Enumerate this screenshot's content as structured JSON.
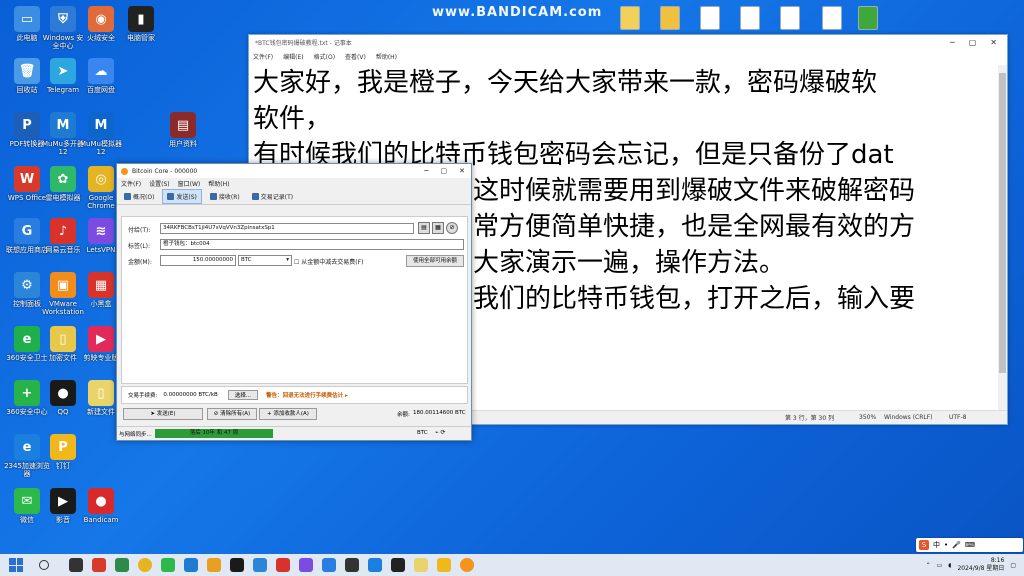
{
  "watermark": "www.BANDICAM.com",
  "desktop_icons": [
    {
      "label": "此电脑",
      "color": "#3a8de0",
      "glyph": "▭"
    },
    {
      "label": "Windows 安全中心",
      "color": "#2d7bd6",
      "glyph": "⛨"
    },
    {
      "label": "火绒安全",
      "color": "#e06a3a",
      "glyph": "◉"
    },
    {
      "label": "电脑管家",
      "color": "#222222",
      "glyph": "▮"
    },
    {
      "label": "回收站",
      "color": "#4a9ae8",
      "glyph": "🗑"
    },
    {
      "label": "Telegram",
      "color": "#2ea6e0",
      "glyph": "➤"
    },
    {
      "label": "百度网盘",
      "color": "#3a86f0",
      "glyph": "☁"
    },
    {
      "label": "PDF转换器",
      "color": "#1d5fb8",
      "glyph": "P"
    },
    {
      "label": "MuMu多开器12",
      "color": "#1f7ad1",
      "glyph": "M"
    },
    {
      "label": "MuMu模拟器12",
      "color": "#0c66cc",
      "glyph": "M"
    },
    {
      "label": "用户资料",
      "color": "#8b2a2a",
      "glyph": "▤"
    },
    {
      "label": "WPS Office",
      "color": "#d83a2a",
      "glyph": "W"
    },
    {
      "label": "雷电模拟器",
      "color": "#2fb86a",
      "glyph": "✿"
    },
    {
      "label": "Google Chrome",
      "color": "#e6b323",
      "glyph": "◎"
    },
    {
      "label": "联想应用商店",
      "color": "#2a7de0",
      "glyph": "G"
    },
    {
      "label": "网易云音乐",
      "color": "#d8322a",
      "glyph": "♪"
    },
    {
      "label": "LetsVPN",
      "color": "#7c4ce0",
      "glyph": "≋"
    },
    {
      "label": "控制面板",
      "color": "#2c86d8",
      "glyph": "⚙"
    },
    {
      "label": "VMware Workstation",
      "color": "#f28c1a",
      "glyph": "▣"
    },
    {
      "label": "小黑盒",
      "color": "#d8332a",
      "glyph": "▦"
    },
    {
      "label": "360安全卫士",
      "color": "#1fb04c",
      "glyph": "e"
    },
    {
      "label": "加密文件",
      "color": "#e8c84a",
      "glyph": "▯"
    },
    {
      "label": "剪映专业版",
      "color": "#e22a5a",
      "glyph": "▶"
    },
    {
      "label": "360安全中心",
      "color": "#27b24a",
      "glyph": "+"
    },
    {
      "label": "QQ",
      "color": "#1a1a1a",
      "glyph": "●"
    },
    {
      "label": "新建文件",
      "color": "#e8d46a",
      "glyph": "▯"
    },
    {
      "label": "2345加速浏览器",
      "color": "#1b7fe0",
      "glyph": "e"
    },
    {
      "label": "钉钉",
      "color": "#f0b81a",
      "glyph": "P"
    },
    {
      "label": "微信",
      "color": "#2db84a",
      "glyph": "✉"
    },
    {
      "label": "影音",
      "color": "#1a1a1a",
      "glyph": "▶"
    },
    {
      "label": "Bandicam",
      "color": "#d82a2a",
      "glyph": "●"
    }
  ],
  "top_icons": [
    {
      "color": "#f2d15a"
    },
    {
      "color": "#f0c040"
    },
    {
      "color": "#ffffff"
    },
    {
      "color": "#ffffff"
    },
    {
      "color": "#ffffff"
    },
    {
      "color": "#ffffff"
    },
    {
      "color": "#3fa83a"
    }
  ],
  "notepad": {
    "title": "*BTC钱包密码爆破教程.txt - 记事本",
    "menu": [
      "文件(F)",
      "编辑(E)",
      "格式(O)",
      "查看(V)",
      "帮助(H)"
    ],
    "lines": [
      "大家好，我是橙子，今天给大家带来一款，密码爆破软",
      "软件，",
      "有时候我们的比特币钱包密码会忘记，但是只备份了dat",
      "这时候就需要用到爆破文件来破解密码",
      "常方便简单快捷，也是全网最有效的方",
      "大家演示一遍，操作方法。",
      "我们的比特币钱包，打开之后，输入要"
    ],
    "status": {
      "pos": "第 3 行，第 30 列",
      "zoom": "350%",
      "eol": "Windows (CRLF)",
      "enc": "UTF-8"
    }
  },
  "bitcoin": {
    "title": "Bitcoin Core - 000000",
    "menu": [
      "文件(F)",
      "设置(S)",
      "窗口(W)",
      "帮助(H)"
    ],
    "tabs": [
      "概况(O)",
      "发送(S)",
      "接收(R)",
      "交易记录(T)"
    ],
    "pay_to_label": "付给(T):",
    "pay_to_value": "34RKFBCBsT1jI4U7sVqVVn3ZpinsatxSp1",
    "label_label": "标签(L):",
    "label_value": "橙子钱包：btc004",
    "amount_label": "金额(M):",
    "amount_value": "150.00000000",
    "unit": "BTC",
    "subtract_fee": "从金额中减去交易费(F)",
    "use_all": "使用全部可用余额",
    "fee_label": "交易手续费:",
    "fee_value": "0.00000000 BTC/kB",
    "choose": "选择...",
    "fee_warning": "警告：回退无法进行手续费估计 ▸",
    "send_btn": "发送(E)",
    "clear_btn": "清除所有(A)",
    "add_recipient": "添加收款人(A)",
    "balance_label": "余额:",
    "balance_value": "180.00114600 BTC",
    "sync_label": "与网络同步...",
    "sync_progress": "落后 10年 和 47 周",
    "status_right": "BTC"
  },
  "taskbar": {
    "time": "8:16",
    "date": "2024/9/8 星期日",
    "ime": [
      "中",
      "•",
      "🎤",
      "⌨"
    ]
  }
}
